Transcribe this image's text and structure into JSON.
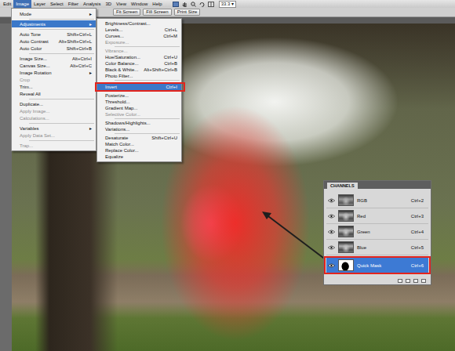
{
  "menubar": {
    "items": [
      {
        "label": "Edit",
        "selected": false
      },
      {
        "label": "Image",
        "selected": true
      },
      {
        "label": "Layer",
        "selected": false
      },
      {
        "label": "Select",
        "selected": false
      },
      {
        "label": "Filter",
        "selected": false
      },
      {
        "label": "Analysis",
        "selected": false
      },
      {
        "label": "3D",
        "selected": false
      },
      {
        "label": "View",
        "selected": false
      },
      {
        "label": "Window",
        "selected": false
      },
      {
        "label": "Help",
        "selected": false
      }
    ],
    "zoom": "33.3",
    "zoom_arrow": "▾"
  },
  "options_bar": {
    "buttons": [
      "Fit Screen",
      "Fill Screen",
      "Print Size"
    ]
  },
  "image_menu": {
    "items": [
      {
        "kind": "item",
        "label": "Mode",
        "arrow": "▸",
        "disabled": false,
        "selected": false
      },
      {
        "kind": "separator"
      },
      {
        "kind": "item",
        "label": "Adjustments",
        "arrow": "▸",
        "disabled": false,
        "selected": true
      },
      {
        "kind": "separator"
      },
      {
        "kind": "item",
        "label": "Auto Tone",
        "shortcut": "Shift+Ctrl+L",
        "disabled": false,
        "selected": false
      },
      {
        "kind": "item",
        "label": "Auto Contrast",
        "shortcut": "Alt+Shift+Ctrl+L",
        "disabled": false,
        "selected": false
      },
      {
        "kind": "item",
        "label": "Auto Color",
        "shortcut": "Shift+Ctrl+B",
        "disabled": false,
        "selected": false
      },
      {
        "kind": "separator"
      },
      {
        "kind": "item",
        "label": "Image Size...",
        "shortcut": "Alt+Ctrl+I",
        "disabled": false,
        "selected": false
      },
      {
        "kind": "item",
        "label": "Canvas Size...",
        "shortcut": "Alt+Ctrl+C",
        "disabled": false,
        "selected": false
      },
      {
        "kind": "item",
        "label": "Image Rotation",
        "arrow": "▸",
        "disabled": false,
        "selected": false
      },
      {
        "kind": "item",
        "label": "Crop",
        "disabled": true,
        "selected": false
      },
      {
        "kind": "item",
        "label": "Trim...",
        "disabled": false,
        "selected": false
      },
      {
        "kind": "item",
        "label": "Reveal All",
        "disabled": false,
        "selected": false
      },
      {
        "kind": "separator"
      },
      {
        "kind": "item",
        "label": "Duplicate...",
        "disabled": false,
        "selected": false
      },
      {
        "kind": "item",
        "label": "Apply Image...",
        "disabled": true,
        "selected": false
      },
      {
        "kind": "item",
        "label": "Calculations...",
        "disabled": true,
        "selected": false
      },
      {
        "kind": "separator"
      },
      {
        "kind": "item",
        "label": "Variables",
        "arrow": "▸",
        "disabled": false,
        "selected": false
      },
      {
        "kind": "item",
        "label": "Apply Data Set...",
        "disabled": true,
        "selected": false
      },
      {
        "kind": "separator"
      },
      {
        "kind": "item",
        "label": "Trap...",
        "disabled": true,
        "selected": false
      }
    ]
  },
  "adjustments_menu": {
    "items": [
      {
        "kind": "item",
        "label": "Brightness/Contrast...",
        "disabled": false,
        "selected": false,
        "callout": false
      },
      {
        "kind": "item",
        "label": "Levels...",
        "shortcut": "Ctrl+L",
        "disabled": false,
        "selected": false,
        "callout": false
      },
      {
        "kind": "item",
        "label": "Curves...",
        "shortcut": "Ctrl+M",
        "disabled": false,
        "selected": false,
        "callout": false
      },
      {
        "kind": "item",
        "label": "Exposure...",
        "disabled": true,
        "selected": false,
        "callout": false
      },
      {
        "kind": "separator"
      },
      {
        "kind": "item",
        "label": "Vibrance...",
        "disabled": true,
        "selected": false,
        "callout": false
      },
      {
        "kind": "item",
        "label": "Hue/Saturation...",
        "shortcut": "Ctrl+U",
        "disabled": false,
        "selected": false,
        "callout": false
      },
      {
        "kind": "item",
        "label": "Color Balance...",
        "shortcut": "Ctrl+B",
        "disabled": false,
        "selected": false,
        "callout": false
      },
      {
        "kind": "item",
        "label": "Black & White...",
        "shortcut": "Alt+Shift+Ctrl+B",
        "disabled": false,
        "selected": false,
        "callout": false
      },
      {
        "kind": "item",
        "label": "Photo Filter...",
        "disabled": false,
        "selected": false,
        "callout": false
      },
      {
        "kind": "separator"
      },
      {
        "kind": "item",
        "label": "Invert",
        "shortcut": "Ctrl+I",
        "disabled": false,
        "selected": true,
        "callout": true
      },
      {
        "kind": "item",
        "label": "Posterize...",
        "disabled": false,
        "selected": false,
        "callout": false
      },
      {
        "kind": "item",
        "label": "Threshold...",
        "disabled": false,
        "selected": false,
        "callout": false
      },
      {
        "kind": "item",
        "label": "Gradient Map...",
        "disabled": false,
        "selected": false,
        "callout": false
      },
      {
        "kind": "item",
        "label": "Selective Color...",
        "disabled": true,
        "selected": false,
        "callout": false
      },
      {
        "kind": "separator"
      },
      {
        "kind": "item",
        "label": "Shadows/Highlights...",
        "disabled": false,
        "selected": false,
        "callout": false
      },
      {
        "kind": "item",
        "label": "Variations...",
        "disabled": false,
        "selected": false,
        "callout": false
      },
      {
        "kind": "separator"
      },
      {
        "kind": "item",
        "label": "Desaturate",
        "shortcut": "Shift+Ctrl+U",
        "disabled": false,
        "selected": false,
        "callout": false
      },
      {
        "kind": "item",
        "label": "Match Color...",
        "disabled": false,
        "selected": false,
        "callout": false
      },
      {
        "kind": "item",
        "label": "Replace Color...",
        "disabled": false,
        "selected": false,
        "callout": false
      },
      {
        "kind": "item",
        "label": "Equalize",
        "disabled": false,
        "selected": false,
        "callout": false
      }
    ]
  },
  "channels_panel": {
    "title": "CHANNELS",
    "rows": [
      {
        "name": "RGB",
        "shortcut": "Ctrl+2",
        "kind": "composite",
        "visible": true,
        "selected": false,
        "callout": false
      },
      {
        "name": "Red",
        "shortcut": "Ctrl+3",
        "kind": "color",
        "visible": true,
        "selected": false,
        "callout": false
      },
      {
        "name": "Green",
        "shortcut": "Ctrl+4",
        "kind": "color",
        "visible": true,
        "selected": false,
        "callout": false
      },
      {
        "name": "Blue",
        "shortcut": "Ctrl+5",
        "kind": "color",
        "visible": true,
        "selected": false,
        "callout": false
      },
      {
        "name": "Quick Mask",
        "shortcut": "Ctrl+6",
        "kind": "mask",
        "visible": true,
        "selected": true,
        "callout": true
      }
    ]
  }
}
